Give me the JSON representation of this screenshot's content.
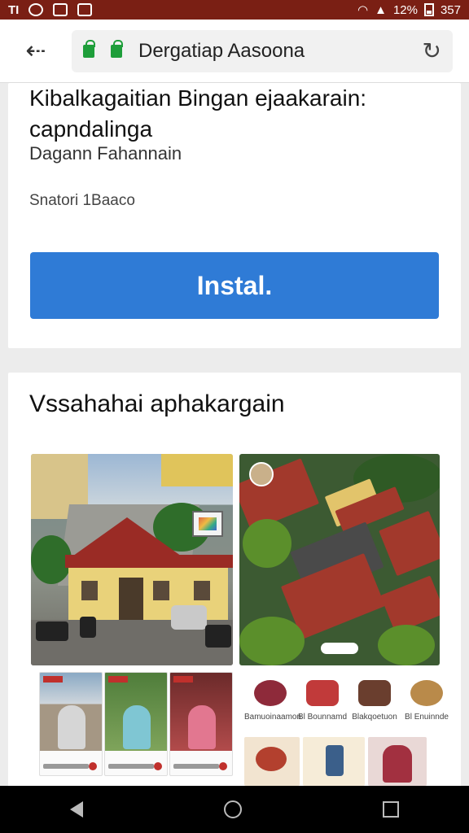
{
  "status_bar": {
    "carrier": "TI",
    "battery_text": "12%",
    "time": "357"
  },
  "browser": {
    "url": "Dergatiap Aasoona"
  },
  "app": {
    "title": "Kibalkagaitian Bingan ejaakarain: capndalinga",
    "developer": "Dagann Fahannain",
    "size_info": "Snatori 1Baaco",
    "install_label": "Instal."
  },
  "screenshots": {
    "section_title": "Vssahahai aphakargain",
    "icons": [
      {
        "label": "Bamuoinaamon",
        "icon": "food-icon"
      },
      {
        "label": "Bl Bounnamd",
        "icon": "gift-icon"
      },
      {
        "label": "Blakqoetuon",
        "icon": "wallet-icon"
      },
      {
        "label": "Bl Enuinnde",
        "icon": "shoes-icon"
      }
    ]
  },
  "colors": {
    "status_bar": "#7a1f14",
    "install_button": "#2f7bd6",
    "lock": "#1e9e3a"
  }
}
